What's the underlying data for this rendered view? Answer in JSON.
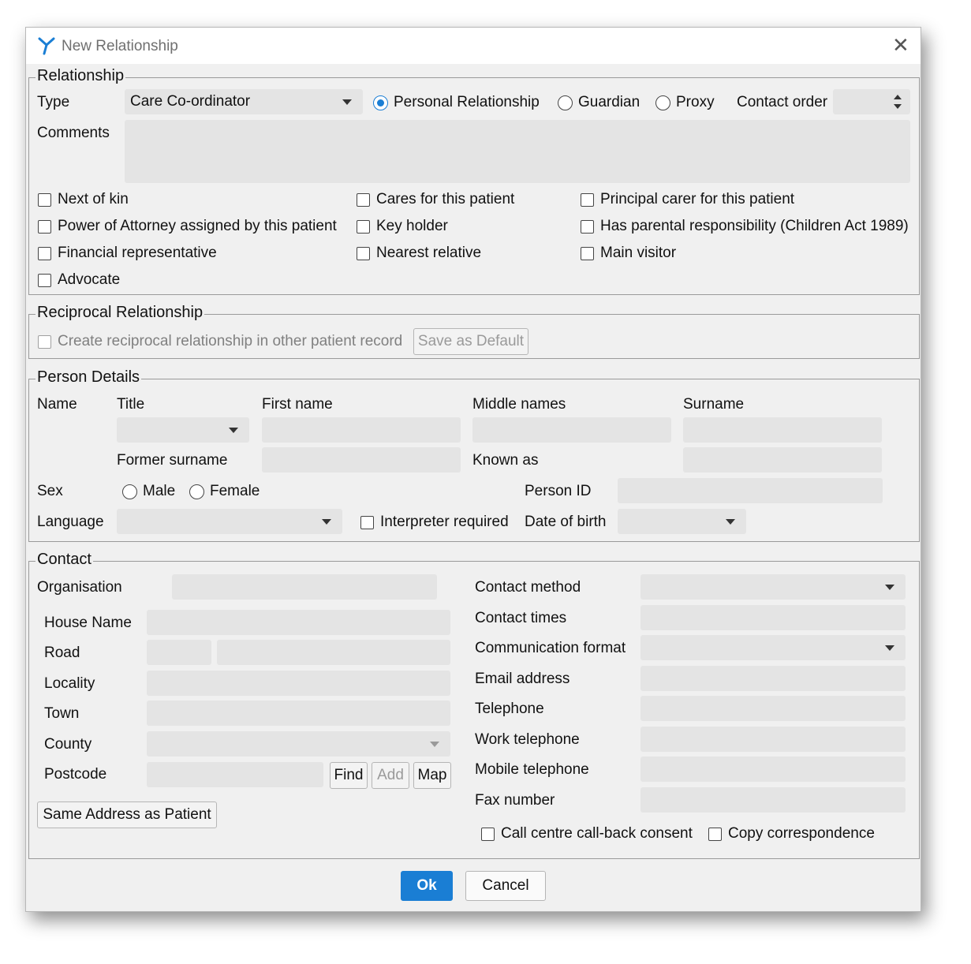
{
  "dialog": {
    "title": "New Relationship",
    "ok_label": "Ok",
    "cancel_label": "Cancel"
  },
  "relationship": {
    "legend": "Relationship",
    "type_label": "Type",
    "type_value": "Care Co-ordinator",
    "radio_personal": "Personal Relationship",
    "radio_guardian": "Guardian",
    "radio_proxy": "Proxy",
    "selected_radio": "Personal Relationship",
    "contact_order_label": "Contact order",
    "comments_label": "Comments",
    "checkboxes": {
      "next_of_kin": "Next of kin",
      "power_of_attorney": "Power of Attorney assigned by this patient",
      "financial_rep": "Financial representative",
      "advocate": "Advocate",
      "cares_for": "Cares for this patient",
      "key_holder": "Key holder",
      "nearest_relative": "Nearest relative",
      "principal_carer": "Principal carer for this patient",
      "parental_responsibility": "Has parental responsibility (Children Act 1989)",
      "main_visitor": "Main visitor"
    }
  },
  "reciprocal": {
    "legend": "Reciprocal Relationship",
    "create_label": "Create reciprocal relationship in other patient record",
    "save_default_label": "Save as Default"
  },
  "person": {
    "legend": "Person Details",
    "name_label": "Name",
    "title_label": "Title",
    "first_name_label": "First name",
    "middle_names_label": "Middle names",
    "surname_label": "Surname",
    "former_surname_label": "Former surname",
    "known_as_label": "Known as",
    "sex_label": "Sex",
    "male_label": "Male",
    "female_label": "Female",
    "person_id_label": "Person ID",
    "language_label": "Language",
    "interpreter_label": "Interpreter required",
    "dob_label": "Date of birth"
  },
  "contact": {
    "legend": "Contact",
    "organisation_label": "Organisation",
    "house_name_label": "House Name",
    "road_label": "Road",
    "locality_label": "Locality",
    "town_label": "Town",
    "county_label": "County",
    "postcode_label": "Postcode",
    "find_label": "Find",
    "add_label": "Add",
    "map_label": "Map",
    "same_address_label": "Same Address as Patient",
    "contact_method_label": "Contact method",
    "contact_times_label": "Contact times",
    "comm_format_label": "Communication format",
    "email_label": "Email address",
    "telephone_label": "Telephone",
    "work_telephone_label": "Work telephone",
    "mobile_label": "Mobile telephone",
    "fax_label": "Fax number",
    "callback_consent_label": "Call centre call-back consent",
    "copy_correspondence_label": "Copy correspondence"
  },
  "colors": {
    "accent": "#1a7ed4",
    "dialog_bg": "#f0f0f0",
    "field_bg": "#e4e4e4"
  }
}
